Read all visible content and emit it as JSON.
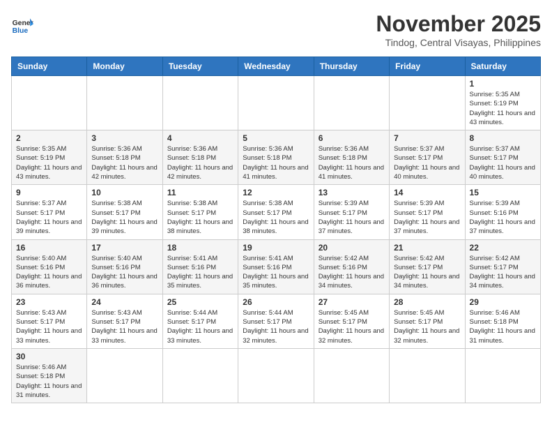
{
  "header": {
    "logo_text_general": "General",
    "logo_text_blue": "Blue",
    "month_title": "November 2025",
    "location": "Tindog, Central Visayas, Philippines"
  },
  "weekdays": [
    "Sunday",
    "Monday",
    "Tuesday",
    "Wednesday",
    "Thursday",
    "Friday",
    "Saturday"
  ],
  "days": [
    {
      "date": "",
      "info": ""
    },
    {
      "date": "",
      "info": ""
    },
    {
      "date": "",
      "info": ""
    },
    {
      "date": "",
      "info": ""
    },
    {
      "date": "",
      "info": ""
    },
    {
      "date": "",
      "info": ""
    },
    {
      "date": "1",
      "sunrise": "Sunrise: 5:35 AM",
      "sunset": "Sunset: 5:19 PM",
      "daylight": "Daylight: 11 hours and 43 minutes."
    },
    {
      "date": "2",
      "sunrise": "Sunrise: 5:35 AM",
      "sunset": "Sunset: 5:19 PM",
      "daylight": "Daylight: 11 hours and 43 minutes."
    },
    {
      "date": "3",
      "sunrise": "Sunrise: 5:36 AM",
      "sunset": "Sunset: 5:18 PM",
      "daylight": "Daylight: 11 hours and 42 minutes."
    },
    {
      "date": "4",
      "sunrise": "Sunrise: 5:36 AM",
      "sunset": "Sunset: 5:18 PM",
      "daylight": "Daylight: 11 hours and 42 minutes."
    },
    {
      "date": "5",
      "sunrise": "Sunrise: 5:36 AM",
      "sunset": "Sunset: 5:18 PM",
      "daylight": "Daylight: 11 hours and 41 minutes."
    },
    {
      "date": "6",
      "sunrise": "Sunrise: 5:36 AM",
      "sunset": "Sunset: 5:18 PM",
      "daylight": "Daylight: 11 hours and 41 minutes."
    },
    {
      "date": "7",
      "sunrise": "Sunrise: 5:37 AM",
      "sunset": "Sunset: 5:17 PM",
      "daylight": "Daylight: 11 hours and 40 minutes."
    },
    {
      "date": "8",
      "sunrise": "Sunrise: 5:37 AM",
      "sunset": "Sunset: 5:17 PM",
      "daylight": "Daylight: 11 hours and 40 minutes."
    },
    {
      "date": "9",
      "sunrise": "Sunrise: 5:37 AM",
      "sunset": "Sunset: 5:17 PM",
      "daylight": "Daylight: 11 hours and 39 minutes."
    },
    {
      "date": "10",
      "sunrise": "Sunrise: 5:38 AM",
      "sunset": "Sunset: 5:17 PM",
      "daylight": "Daylight: 11 hours and 39 minutes."
    },
    {
      "date": "11",
      "sunrise": "Sunrise: 5:38 AM",
      "sunset": "Sunset: 5:17 PM",
      "daylight": "Daylight: 11 hours and 38 minutes."
    },
    {
      "date": "12",
      "sunrise": "Sunrise: 5:38 AM",
      "sunset": "Sunset: 5:17 PM",
      "daylight": "Daylight: 11 hours and 38 minutes."
    },
    {
      "date": "13",
      "sunrise": "Sunrise: 5:39 AM",
      "sunset": "Sunset: 5:17 PM",
      "daylight": "Daylight: 11 hours and 37 minutes."
    },
    {
      "date": "14",
      "sunrise": "Sunrise: 5:39 AM",
      "sunset": "Sunset: 5:17 PM",
      "daylight": "Daylight: 11 hours and 37 minutes."
    },
    {
      "date": "15",
      "sunrise": "Sunrise: 5:39 AM",
      "sunset": "Sunset: 5:16 PM",
      "daylight": "Daylight: 11 hours and 37 minutes."
    },
    {
      "date": "16",
      "sunrise": "Sunrise: 5:40 AM",
      "sunset": "Sunset: 5:16 PM",
      "daylight": "Daylight: 11 hours and 36 minutes."
    },
    {
      "date": "17",
      "sunrise": "Sunrise: 5:40 AM",
      "sunset": "Sunset: 5:16 PM",
      "daylight": "Daylight: 11 hours and 36 minutes."
    },
    {
      "date": "18",
      "sunrise": "Sunrise: 5:41 AM",
      "sunset": "Sunset: 5:16 PM",
      "daylight": "Daylight: 11 hours and 35 minutes."
    },
    {
      "date": "19",
      "sunrise": "Sunrise: 5:41 AM",
      "sunset": "Sunset: 5:16 PM",
      "daylight": "Daylight: 11 hours and 35 minutes."
    },
    {
      "date": "20",
      "sunrise": "Sunrise: 5:42 AM",
      "sunset": "Sunset: 5:16 PM",
      "daylight": "Daylight: 11 hours and 34 minutes."
    },
    {
      "date": "21",
      "sunrise": "Sunrise: 5:42 AM",
      "sunset": "Sunset: 5:17 PM",
      "daylight": "Daylight: 11 hours and 34 minutes."
    },
    {
      "date": "22",
      "sunrise": "Sunrise: 5:42 AM",
      "sunset": "Sunset: 5:17 PM",
      "daylight": "Daylight: 11 hours and 34 minutes."
    },
    {
      "date": "23",
      "sunrise": "Sunrise: 5:43 AM",
      "sunset": "Sunset: 5:17 PM",
      "daylight": "Daylight: 11 hours and 33 minutes."
    },
    {
      "date": "24",
      "sunrise": "Sunrise: 5:43 AM",
      "sunset": "Sunset: 5:17 PM",
      "daylight": "Daylight: 11 hours and 33 minutes."
    },
    {
      "date": "25",
      "sunrise": "Sunrise: 5:44 AM",
      "sunset": "Sunset: 5:17 PM",
      "daylight": "Daylight: 11 hours and 33 minutes."
    },
    {
      "date": "26",
      "sunrise": "Sunrise: 5:44 AM",
      "sunset": "Sunset: 5:17 PM",
      "daylight": "Daylight: 11 hours and 32 minutes."
    },
    {
      "date": "27",
      "sunrise": "Sunrise: 5:45 AM",
      "sunset": "Sunset: 5:17 PM",
      "daylight": "Daylight: 11 hours and 32 minutes."
    },
    {
      "date": "28",
      "sunrise": "Sunrise: 5:45 AM",
      "sunset": "Sunset: 5:17 PM",
      "daylight": "Daylight: 11 hours and 32 minutes."
    },
    {
      "date": "29",
      "sunrise": "Sunrise: 5:46 AM",
      "sunset": "Sunset: 5:18 PM",
      "daylight": "Daylight: 11 hours and 31 minutes."
    },
    {
      "date": "30",
      "sunrise": "Sunrise: 5:46 AM",
      "sunset": "Sunset: 5:18 PM",
      "daylight": "Daylight: 11 hours and 31 minutes."
    }
  ]
}
